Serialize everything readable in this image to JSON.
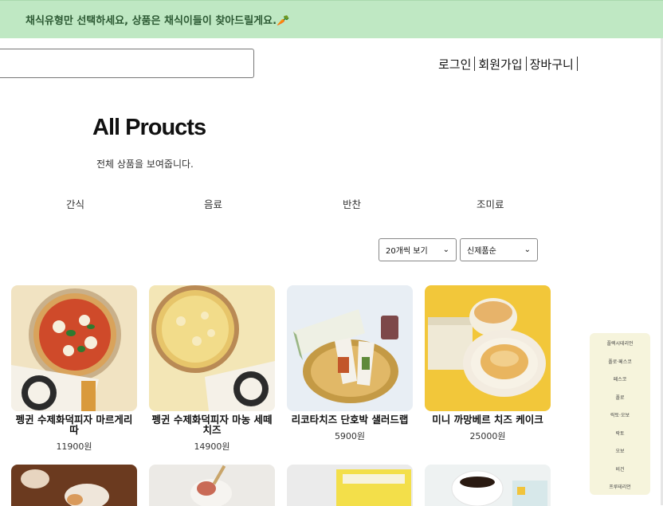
{
  "banner": {
    "text": "채식유형만 선택하세요, 상품은 채식이들이 찾아드릴게요.🥕"
  },
  "nav": {
    "login": "로그인",
    "signup": "회원가입",
    "cart": "장바구니"
  },
  "page": {
    "title": "All Proucts",
    "subtitle": "전체 상품을 보여줍니다."
  },
  "categories": [
    "간식",
    "음료",
    "반찬",
    "조미료"
  ],
  "controls": {
    "per_page": "20개씩 보기",
    "sort": "신제품순"
  },
  "products": [
    {
      "name": "펭귄 수제화덕피자 마르게리따",
      "price": "11900원"
    },
    {
      "name": "펭귄 수제화덕피자 마농 세떼 치즈",
      "price": "14900원"
    },
    {
      "name": "리코타치즈 단호박 샐러드랩",
      "price": "5900원"
    },
    {
      "name": "미니 까망베르 치즈 케이크",
      "price": "25000원"
    }
  ],
  "side_menu": [
    "플렉시테리언",
    "폴로·페스코",
    "페스코",
    "폴로",
    "락토·오보",
    "락토",
    "오보",
    "비건",
    "프루테리언"
  ],
  "colors": {
    "banner_bg": "#bfe8c3",
    "side_bg": "#f6f4dc"
  }
}
